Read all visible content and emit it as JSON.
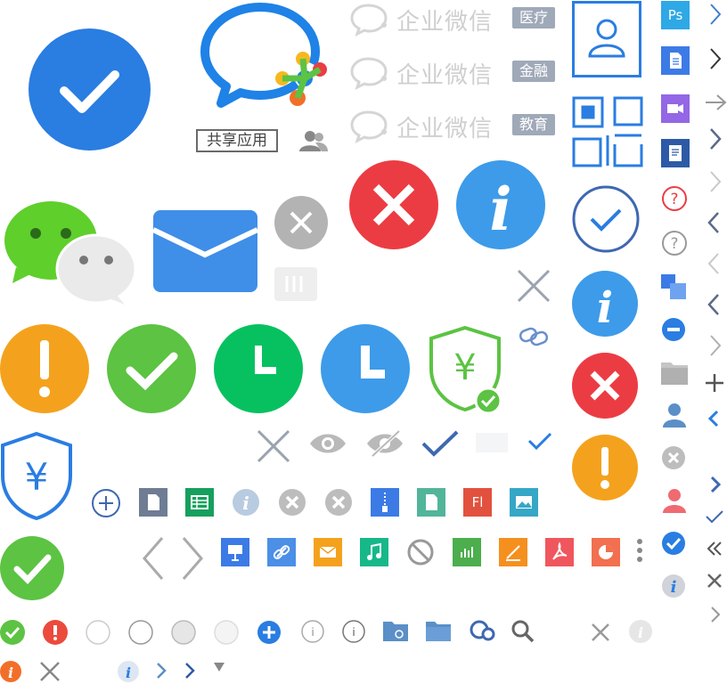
{
  "brand": {
    "wework_label": "企业微信",
    "tags": [
      "医疗",
      "金融",
      "教育"
    ],
    "shared_apps_label": "共享应用"
  },
  "file_badges": {
    "photoshop": "Ps",
    "flash": "Fl"
  },
  "colors": {
    "blue": "#2a7de1",
    "light_blue": "#3d9be9",
    "green": "#5cc343",
    "wechat_green": "#07c160",
    "red": "#ec3c43",
    "orange": "#f4a21d",
    "grey": "#b3b3b3",
    "dark_blue": "#3e68b1",
    "slate": "#5b6a89"
  },
  "icons": [
    "check-circle-icon",
    "wework-logo-icon",
    "wework-brand-icon",
    "shared-apps-badge",
    "contacts-group-icon",
    "user-profile-icon",
    "qr-code-icon",
    "photoshop-file-icon",
    "document-file-icon",
    "video-file-icon",
    "note-file-icon",
    "chevron-right-icon",
    "chevron-left-icon",
    "arrow-right-icon",
    "wechat-logo-icon",
    "mail-envelope-icon",
    "close-circle-icon",
    "error-circle-icon",
    "info-circle-icon",
    "warning-circle-icon",
    "clock-icon",
    "shield-yen-icon",
    "eye-icon",
    "eye-off-icon",
    "checkmark-icon",
    "add-circle-icon",
    "spreadsheet-file-icon",
    "zip-file-icon",
    "image-file-icon",
    "presentation-file-icon",
    "link-file-icon",
    "email-file-icon",
    "audio-file-icon",
    "forbidden-icon",
    "chart-file-icon",
    "sketch-file-icon",
    "pdf-file-icon",
    "pie-chart-file-icon",
    "more-vertical-icon",
    "folder-icon",
    "folder-link-icon",
    "search-icon",
    "question-circle-icon",
    "layers-icon",
    "minus-circle-icon",
    "plus-icon",
    "person-icon",
    "radio-empty-icon",
    "double-chevron-left-icon",
    "link-icon",
    "triangle-down-icon"
  ]
}
